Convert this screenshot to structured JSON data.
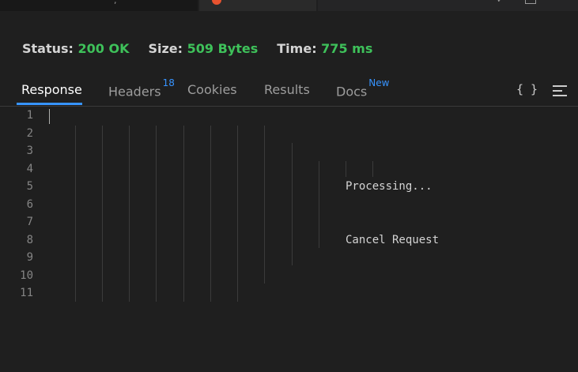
{
  "status": {
    "status_label": "Status:",
    "status_value": "200 OK",
    "size_label": "Size:",
    "size_value": "509 Bytes",
    "time_label": "Time:",
    "time_value": "775 ms"
  },
  "tabs": [
    {
      "label": "Response",
      "badge": ""
    },
    {
      "label": "Headers",
      "badge": "18"
    },
    {
      "label": "Cookies",
      "badge": ""
    },
    {
      "label": "Results",
      "badge": ""
    },
    {
      "label": "Docs",
      "badge": "New"
    }
  ],
  "toolbar": {
    "braces_glyph": "{ }"
  },
  "editor": {
    "line_numbers": [
      "1",
      "2",
      "3",
      "4",
      "5",
      "6",
      "7",
      "8",
      "9",
      "10",
      "11"
    ],
    "processing_text": "Processing...",
    "cancel_text": "Cancel Request"
  },
  "colors": {
    "accent": "#3794ff",
    "success": "#3ec15a",
    "background": "#1f1f1f"
  }
}
